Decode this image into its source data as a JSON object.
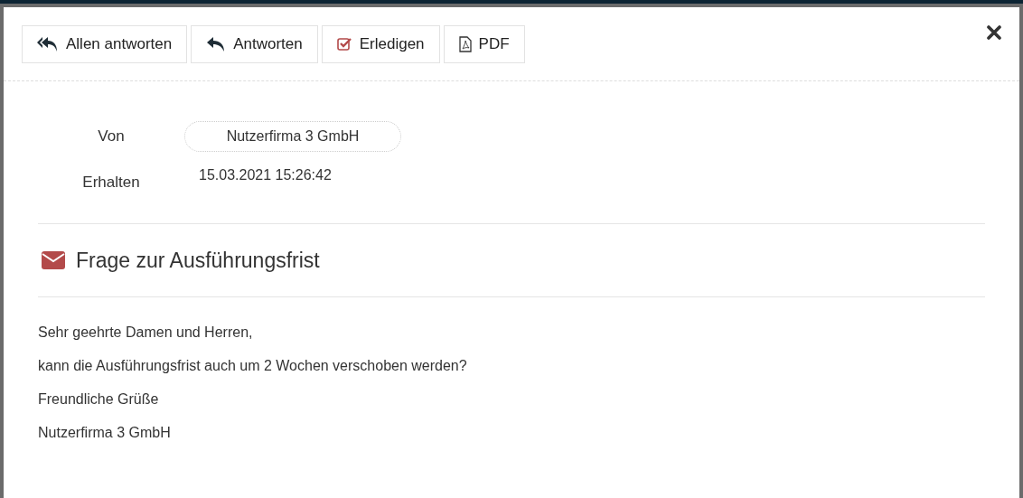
{
  "toolbar": {
    "buttons": [
      {
        "label": "Allen antworten",
        "kind": "reply-all"
      },
      {
        "label": "Antworten",
        "kind": "reply"
      },
      {
        "label": "Erledigen",
        "kind": "done"
      },
      {
        "label": "PDF",
        "kind": "pdf"
      }
    ]
  },
  "header": [
    {
      "label": "Von",
      "value": "Nutzerfirma 3 GmbH",
      "kind": "chip"
    },
    {
      "label": "Erhalten",
      "value": "15.03.2021 15:26:42",
      "kind": "text"
    }
  ],
  "subject": "Frage zur Ausführungsfrist",
  "body": [
    "Sehr geehrte Damen und Herren,",
    "kann die Ausführungsfrist auch um 2 Wochen verschoben werden?",
    "Freundliche Grüße",
    "Nutzerfirma 3 GmbH"
  ]
}
